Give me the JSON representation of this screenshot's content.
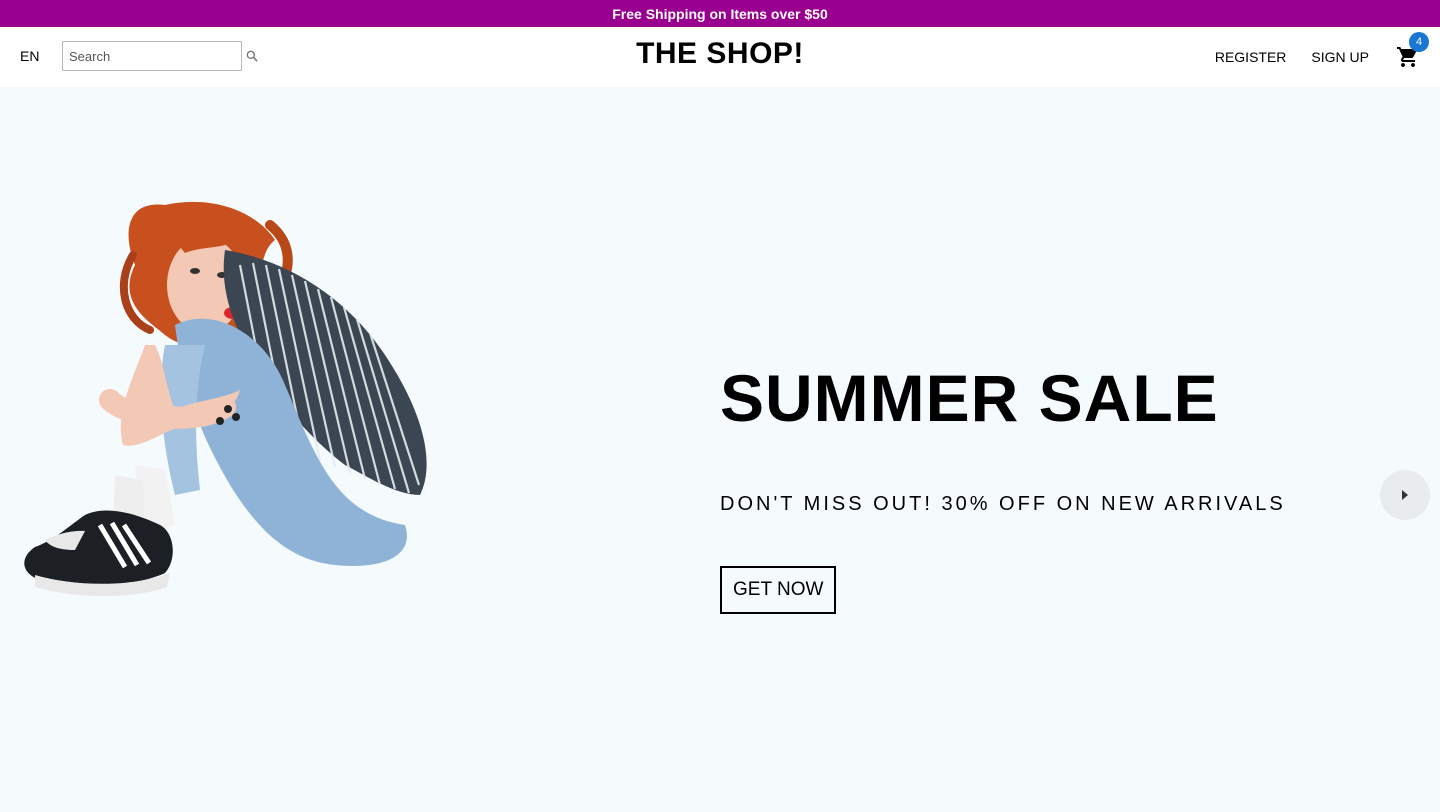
{
  "announcement": {
    "text": "Free Shipping on Items over $50",
    "background_color": "#990090"
  },
  "navbar": {
    "language": "EN",
    "search": {
      "placeholder": "Search",
      "value": "",
      "icon": "search-icon"
    },
    "logo": "THE SHOP!",
    "links": {
      "register": "REGISTER",
      "sign_up": "SIGN UP"
    },
    "cart": {
      "icon": "shopping-cart-icon",
      "count": "4",
      "badge_color": "#1976d2"
    }
  },
  "hero": {
    "background_color": "#f5fafd",
    "title": "SUMMER SALE",
    "subtitle": "DON'T MISS OUT! 30% OFF ON NEW ARRIVALS",
    "button_label": "GET NOW",
    "image": "woman-sitting-hugging-knees",
    "next_arrow_icon": "arrow-right-icon"
  }
}
